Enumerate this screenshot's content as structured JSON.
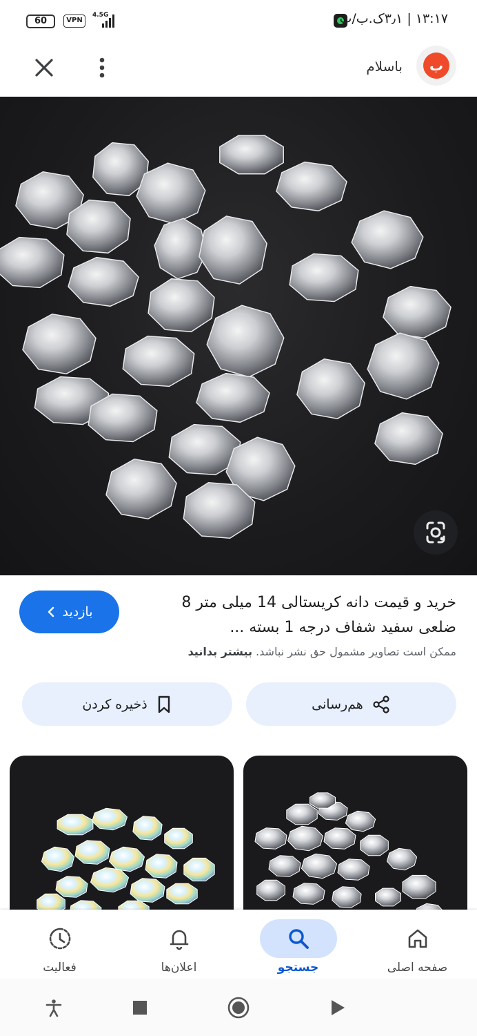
{
  "status_bar": {
    "time": "۱۳:۱۷ | ۳٫۱ک.ب/ث",
    "battery": "60",
    "vpn": "VPN",
    "network": "4.5G"
  },
  "header": {
    "site_name": "باسلام",
    "logo_letter": "ب",
    "close_icon": "close-icon",
    "more_icon": "more-vert-icon"
  },
  "hero": {
    "lens_icon": "google-lens-icon"
  },
  "result": {
    "title": "خرید و قیمت دانه کریستالی 14 میلی متر 8 ضلعی سفید شفاف درجه 1 بسته ...",
    "visit_label": "بازدید",
    "copyright_text": "ممکن است تصاویر مشمول حق نشر نباشد.",
    "learn_more": "بیشتر بدانید"
  },
  "actions": {
    "share_label": "هم‌رسانی",
    "save_label": "ذخیره کردن"
  },
  "bottom_nav": {
    "items": [
      {
        "label": "صفحه اصلی",
        "icon": "home-icon"
      },
      {
        "label": "جستجو",
        "icon": "search-icon",
        "active": true
      },
      {
        "label": "اعلان‌ها",
        "icon": "bell-icon"
      },
      {
        "label": "فعالیت",
        "icon": "activity-icon"
      }
    ]
  },
  "colors": {
    "accent": "#1a73e8",
    "action_bg": "#e8f0fe",
    "active_nav_bg": "#d3e3fd",
    "logo": "#ef4b2b"
  }
}
